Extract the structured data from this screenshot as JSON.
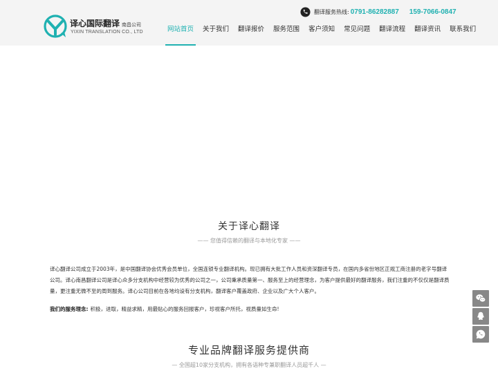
{
  "brand": {
    "name_cn": "译心国际翻译",
    "sub_cn": "南昌公司",
    "name_en": "YIXIN TRANSLATION CO., LTD"
  },
  "hotline": {
    "label": "翻译服务热线:",
    "phone_1": "0791-86282887",
    "phone_2": "159-7066-0847"
  },
  "nav": {
    "items": [
      {
        "label": "网站首页",
        "active": true
      },
      {
        "label": "关于我们"
      },
      {
        "label": "翻译报价"
      },
      {
        "label": "服务范围"
      },
      {
        "label": "客户须知"
      },
      {
        "label": "常见问题"
      },
      {
        "label": "翻译流程"
      },
      {
        "label": "翻译资讯"
      },
      {
        "label": "联系我们"
      }
    ]
  },
  "about": {
    "title": "关于译心翻译",
    "subtitle": "—— 您值得信赖的翻译与本地化专家 ——",
    "paragraph_1": "译心翻译公司成立于2003年，是中国翻译协会优秀会员单位，全国连锁专业翻译机构。现已拥有大批工作人员和资深翻译专员，在国内多省份地区正规工商注册的老字号翻译公司。译心南昌翻译公司是译心众多分支机构中经营较为优秀的公司之一，公司秉承质量第一、服务至上的经营理念，为客户提供最好的翻译服务，我们注重的不仅仅是翻译质量，更注重无微不至的周到服务。译心公司目前在各地均设有分支机构，翻译客户覆盖政府、企业以及广大个人客户。",
    "concept_label": "我们的服务理念:",
    "concept_text": "积极，进取，精益求精，用最贴心的服务回报客户，珍视客户所托，视质量如生命!"
  },
  "brand_section": {
    "title": "专业品牌翻译服务提供商",
    "subtitle": "— 全国超10家分支机构，拥有各语种专兼职翻译人员超千人 —"
  },
  "colors": {
    "accent": "#1fb1b1",
    "header_bg": "#f4f4f4",
    "side_btn": "#888888"
  },
  "icons": {
    "logo": "yixin-logo-icon",
    "phone": "phone-icon",
    "side_tools": [
      "wechat-icon",
      "qq-icon",
      "whatsapp-icon"
    ]
  }
}
